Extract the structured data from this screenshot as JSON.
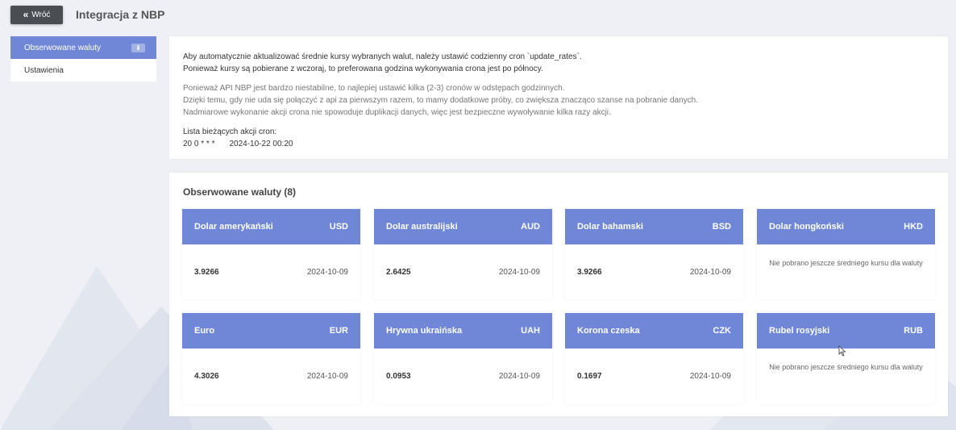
{
  "header": {
    "back_label": "Wróć",
    "title": "Integracja z NBP"
  },
  "sidebar": {
    "items": [
      {
        "label": "Obserwowane waluty",
        "active": true
      },
      {
        "label": "Ustawienia",
        "active": false
      }
    ]
  },
  "info": {
    "line1": "Aby automatycznie aktualizować średnie kursy wybranych walut, należy ustawić codzienny cron `update_rates`.",
    "line2": "Ponieważ kursy są pobierane z wczoraj, to preferowana godzina wykonywania crona jest po północy.",
    "line3": "Ponieważ API NBP jest bardzo niestabilne, to najlepiej ustawić kilka (2-3) cronów w odstępach godzinnych.",
    "line4": "Dzięki temu, gdy nie uda się połączyć z api za pierwszym razem, to mamy dodatkowe próby, co zwiększa znacząco szanse na pobranie danych.",
    "line5": "Nadmiarowe wykonanie akcji crona nie spowoduje duplikacji danych, więc jest bezpieczne wywoływanie kilka razy akcji.",
    "cron_list_label": "Lista bieżących akcji cron:",
    "cron_expr": "20 0 * * *",
    "cron_next": "2024-10-22 00:20"
  },
  "currencies": {
    "title": "Obserwowane waluty (8)",
    "cards": [
      {
        "name": "Dolar amerykański",
        "code": "USD",
        "rate": "3.9266",
        "date": "2024-10-09"
      },
      {
        "name": "Dolar australijski",
        "code": "AUD",
        "rate": "2.6425",
        "date": "2024-10-09"
      },
      {
        "name": "Dolar bahamski",
        "code": "BSD",
        "rate": "3.9266",
        "date": "2024-10-09"
      },
      {
        "name": "Dolar hongkoński",
        "code": "HKD",
        "empty": "Nie pobrano jeszcze średniego kursu dla waluty"
      },
      {
        "name": "Euro",
        "code": "EUR",
        "rate": "4.3026",
        "date": "2024-10-09"
      },
      {
        "name": "Hrywna ukraińska",
        "code": "UAH",
        "rate": "0.0953",
        "date": "2024-10-09"
      },
      {
        "name": "Korona czeska",
        "code": "CZK",
        "rate": "0.1697",
        "date": "2024-10-09"
      },
      {
        "name": "Rubel rosyjski",
        "code": "RUB",
        "empty": "Nie pobrano jeszcze średniego kursu dla waluty"
      }
    ]
  },
  "colors": {
    "accent": "#6f87d6",
    "back_button": "#4a4d52"
  }
}
